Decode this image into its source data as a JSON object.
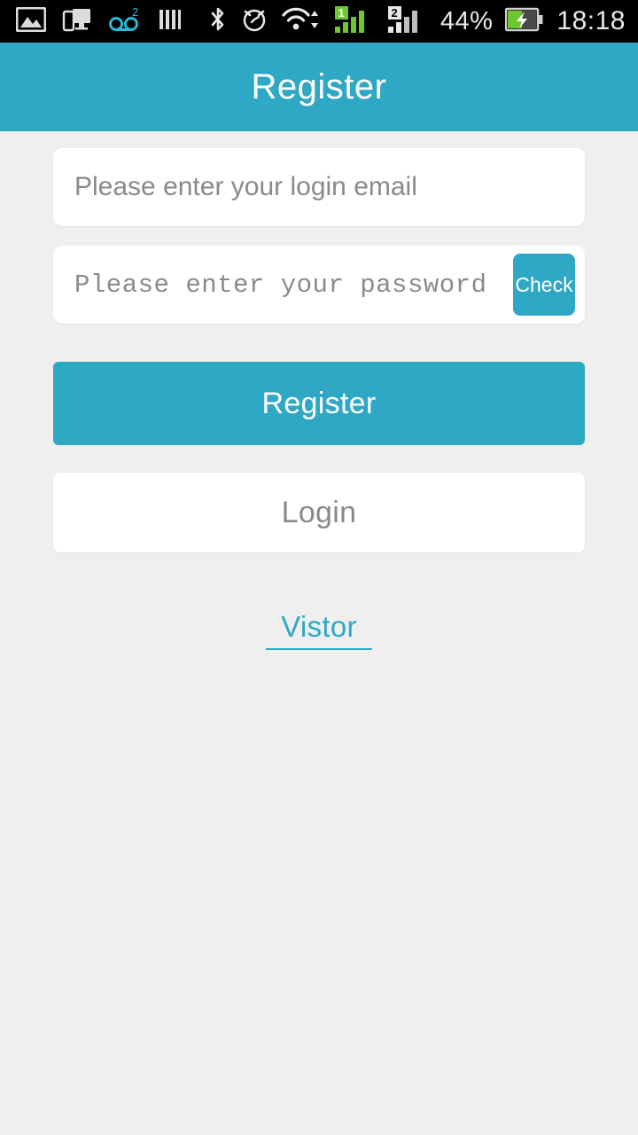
{
  "status_bar": {
    "icons": [
      {
        "name": "photo-gallery-icon",
        "label": "gallery"
      },
      {
        "name": "screen-mirroring-icon",
        "label": "screen mirroring"
      },
      {
        "name": "voicemail-icon",
        "label": "voicemail",
        "badge": "2"
      },
      {
        "name": "vertical-bars-icon",
        "label": "sd card"
      },
      {
        "name": "bluetooth-icon",
        "label": "bluetooth"
      },
      {
        "name": "alarm-clock-icon",
        "label": "alarm"
      },
      {
        "name": "wifi-icon",
        "label": "wifi"
      },
      {
        "name": "signal-sim1-icon",
        "label": "sim 1 signal",
        "badge": "1"
      },
      {
        "name": "signal-sim2-icon",
        "label": "sim 2 signal",
        "badge": "2"
      },
      {
        "name": "battery-charging-icon",
        "label": "battery charging"
      }
    ],
    "sim1_badge": "1",
    "sim2_badge": "2",
    "voicemail_badge": "2",
    "battery_percent": "44%",
    "clock": "18:18"
  },
  "header": {
    "title": "Register"
  },
  "form": {
    "email": {
      "placeholder": "Please enter your login email",
      "value": ""
    },
    "password": {
      "placeholder": "Please enter your password",
      "value": ""
    },
    "check_label": "Check"
  },
  "actions": {
    "register_label": "Register",
    "login_label": "Login",
    "visitor_label": "Vistor"
  },
  "colors": {
    "accent": "#2ea8c4",
    "background": "#efefef",
    "card": "#ffffff",
    "status_bar": "#000000",
    "placeholder_text": "#8a8a8a",
    "signal_green": "#6ec72e",
    "voicemail_cyan": "#29b6d8"
  }
}
